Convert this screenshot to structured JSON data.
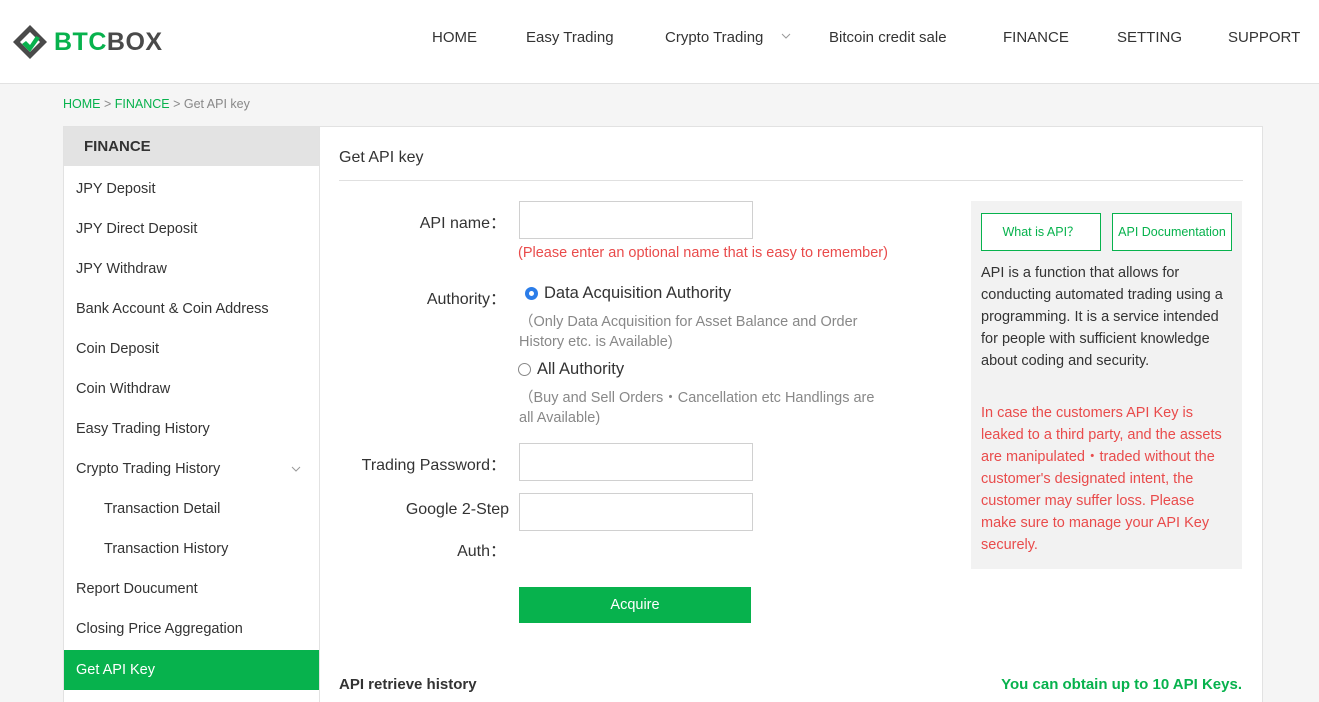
{
  "brand": {
    "part1": "BTC",
    "part2": "BOX"
  },
  "nav": [
    {
      "label": "HOME"
    },
    {
      "label": "Easy Trading"
    },
    {
      "label": "Crypto Trading"
    },
    {
      "label": "Bitcoin credit sale"
    },
    {
      "label": "FINANCE"
    },
    {
      "label": "SETTING"
    },
    {
      "label": "SUPPORT"
    }
  ],
  "breadcrumb": {
    "home": "HOME",
    "sep1": " > ",
    "finance": "FINANCE",
    "sep2": " > ",
    "current": "Get API key"
  },
  "sidebar": {
    "heading": "FINANCE",
    "items": [
      {
        "label": "JPY Deposit"
      },
      {
        "label": "JPY Direct Deposit"
      },
      {
        "label": "JPY Withdraw"
      },
      {
        "label": "Bank Account & Coin Address"
      },
      {
        "label": "Coin Deposit"
      },
      {
        "label": "Coin Withdraw"
      },
      {
        "label": "Easy Trading History"
      },
      {
        "label": "Crypto Trading History"
      },
      {
        "label": "Transaction Detail"
      },
      {
        "label": "Transaction History"
      },
      {
        "label": "Report Doucument"
      },
      {
        "label": "Closing Price Aggregation"
      },
      {
        "label": "Get API Key"
      }
    ]
  },
  "form": {
    "title": "Get API key",
    "api_name_label": "API name：",
    "api_name_value": "",
    "api_name_hint": "(Please enter an optional name that is easy to remember)",
    "authority_label": "Authority：",
    "option1_label": "Data Acquisition Authority",
    "option1_note": "（Only Data Acquisition for Asset Balance and Order History etc. is Available)",
    "option2_label": "All Authority",
    "option2_note": "（Buy and Sell Orders・Cancellation etc Handlings are all Available)",
    "trading_password_label": "Trading Password：",
    "trading_password_value": "",
    "g2fa_label_line1": "Google 2-Step",
    "g2fa_label_line2": "Auth：",
    "g2fa_value": "",
    "acquire_label": "Acquire"
  },
  "info": {
    "what_is_api": "What is API？",
    "api_docs": "API Documentation",
    "description": "API is a function that allows for conducting automated trading using a programming. It is a service intended for people with sufficient knowledge about coding and security.",
    "warning": "In case the customers API Key is leaked to a third party, and the assets are manipulated・traded without the customer's designated intent, the customer may suffer loss. Please make sure to manage your API Key securely."
  },
  "history": {
    "title": "API retrieve history",
    "limit_note": "You can obtain up to 10 API Keys."
  },
  "colors": {
    "brand_green": "#07b24d",
    "warning_red": "#e94b4b",
    "radio_blue": "#2b7de9"
  }
}
